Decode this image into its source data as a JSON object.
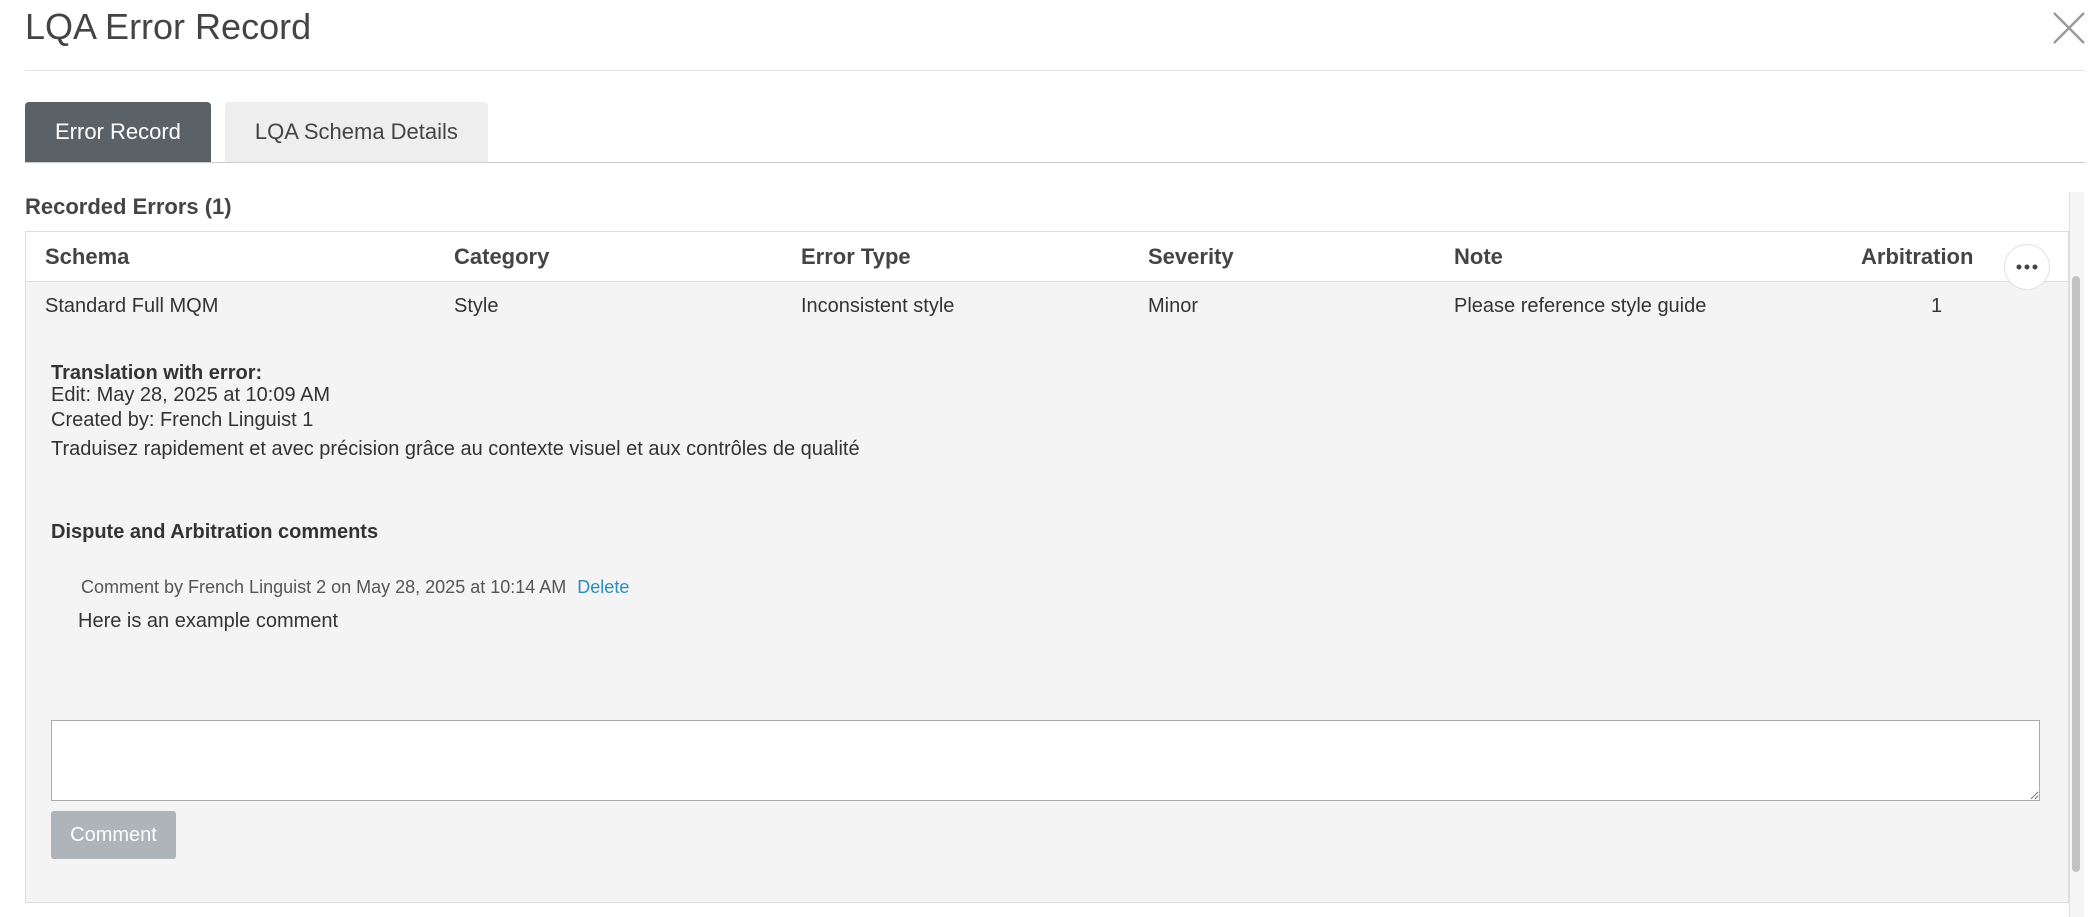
{
  "dialog": {
    "title": "LQA Error Record",
    "close_icon": "close-icon"
  },
  "tabs": [
    {
      "label": "Error Record",
      "active": true
    },
    {
      "label": "LQA Schema Details",
      "active": false
    }
  ],
  "recorded_errors": {
    "title": "Recorded Errors (1)",
    "columns": [
      "Schema",
      "Category",
      "Error Type",
      "Severity",
      "Note",
      "Arbitration"
    ],
    "rows": [
      {
        "schema": "Standard Full MQM",
        "category": "Style",
        "error_type": "Inconsistent style",
        "severity": "Minor",
        "note": "Please reference style guide",
        "arbitration": "1",
        "more_icon": "more-horizontal-icon"
      }
    ]
  },
  "translation": {
    "label": "Translation with error:",
    "edit": "Edit: May 28, 2025 at 10:09 AM",
    "created_by": "Created by: French Linguist 1",
    "text": "Traduisez rapidement et avec précision grâce au contexte visuel et aux contrôles de qualité"
  },
  "dispute": {
    "title": "Dispute and Arbitration comments",
    "comments": [
      {
        "meta": "Comment by French Linguist 2 on May 28, 2025 at 10:14 AM",
        "delete_label": "Delete",
        "text": "Here is an example comment"
      }
    ],
    "input_value": "",
    "submit_label": "Comment"
  },
  "colors": {
    "active_tab": "#5a6268",
    "inactive_tab": "#eeeeee",
    "panel_background": "#f3f4f3",
    "link": "#2b8cbe",
    "disabled_button": "#aeb4b7"
  }
}
